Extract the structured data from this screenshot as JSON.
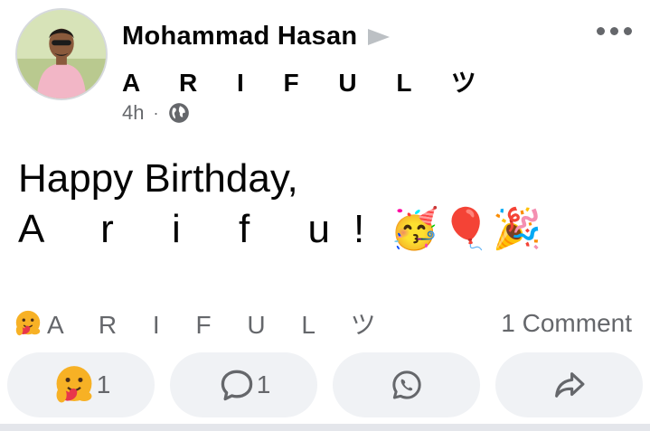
{
  "post": {
    "author": "Mohammad Hasan",
    "target": "A R I F U L ツ",
    "time": "4h",
    "separator": "·",
    "text_line1": "Happy Birthday,",
    "text_line2": "A r i f u!",
    "emojis": [
      "🥳",
      "🎈",
      "🎉"
    ]
  },
  "summary": {
    "reactor": "A R I F U L ツ",
    "comments": "1 Comment"
  },
  "actions": {
    "react_count": "1",
    "comment_count": "1"
  },
  "icons": [
    "care-reaction-icon",
    "globe-icon",
    "more-icon",
    "comment-icon",
    "whatsapp-icon",
    "share-icon"
  ],
  "colors": {
    "muted": "#65676b",
    "button_bg": "#f0f2f5",
    "text": "#050505"
  }
}
